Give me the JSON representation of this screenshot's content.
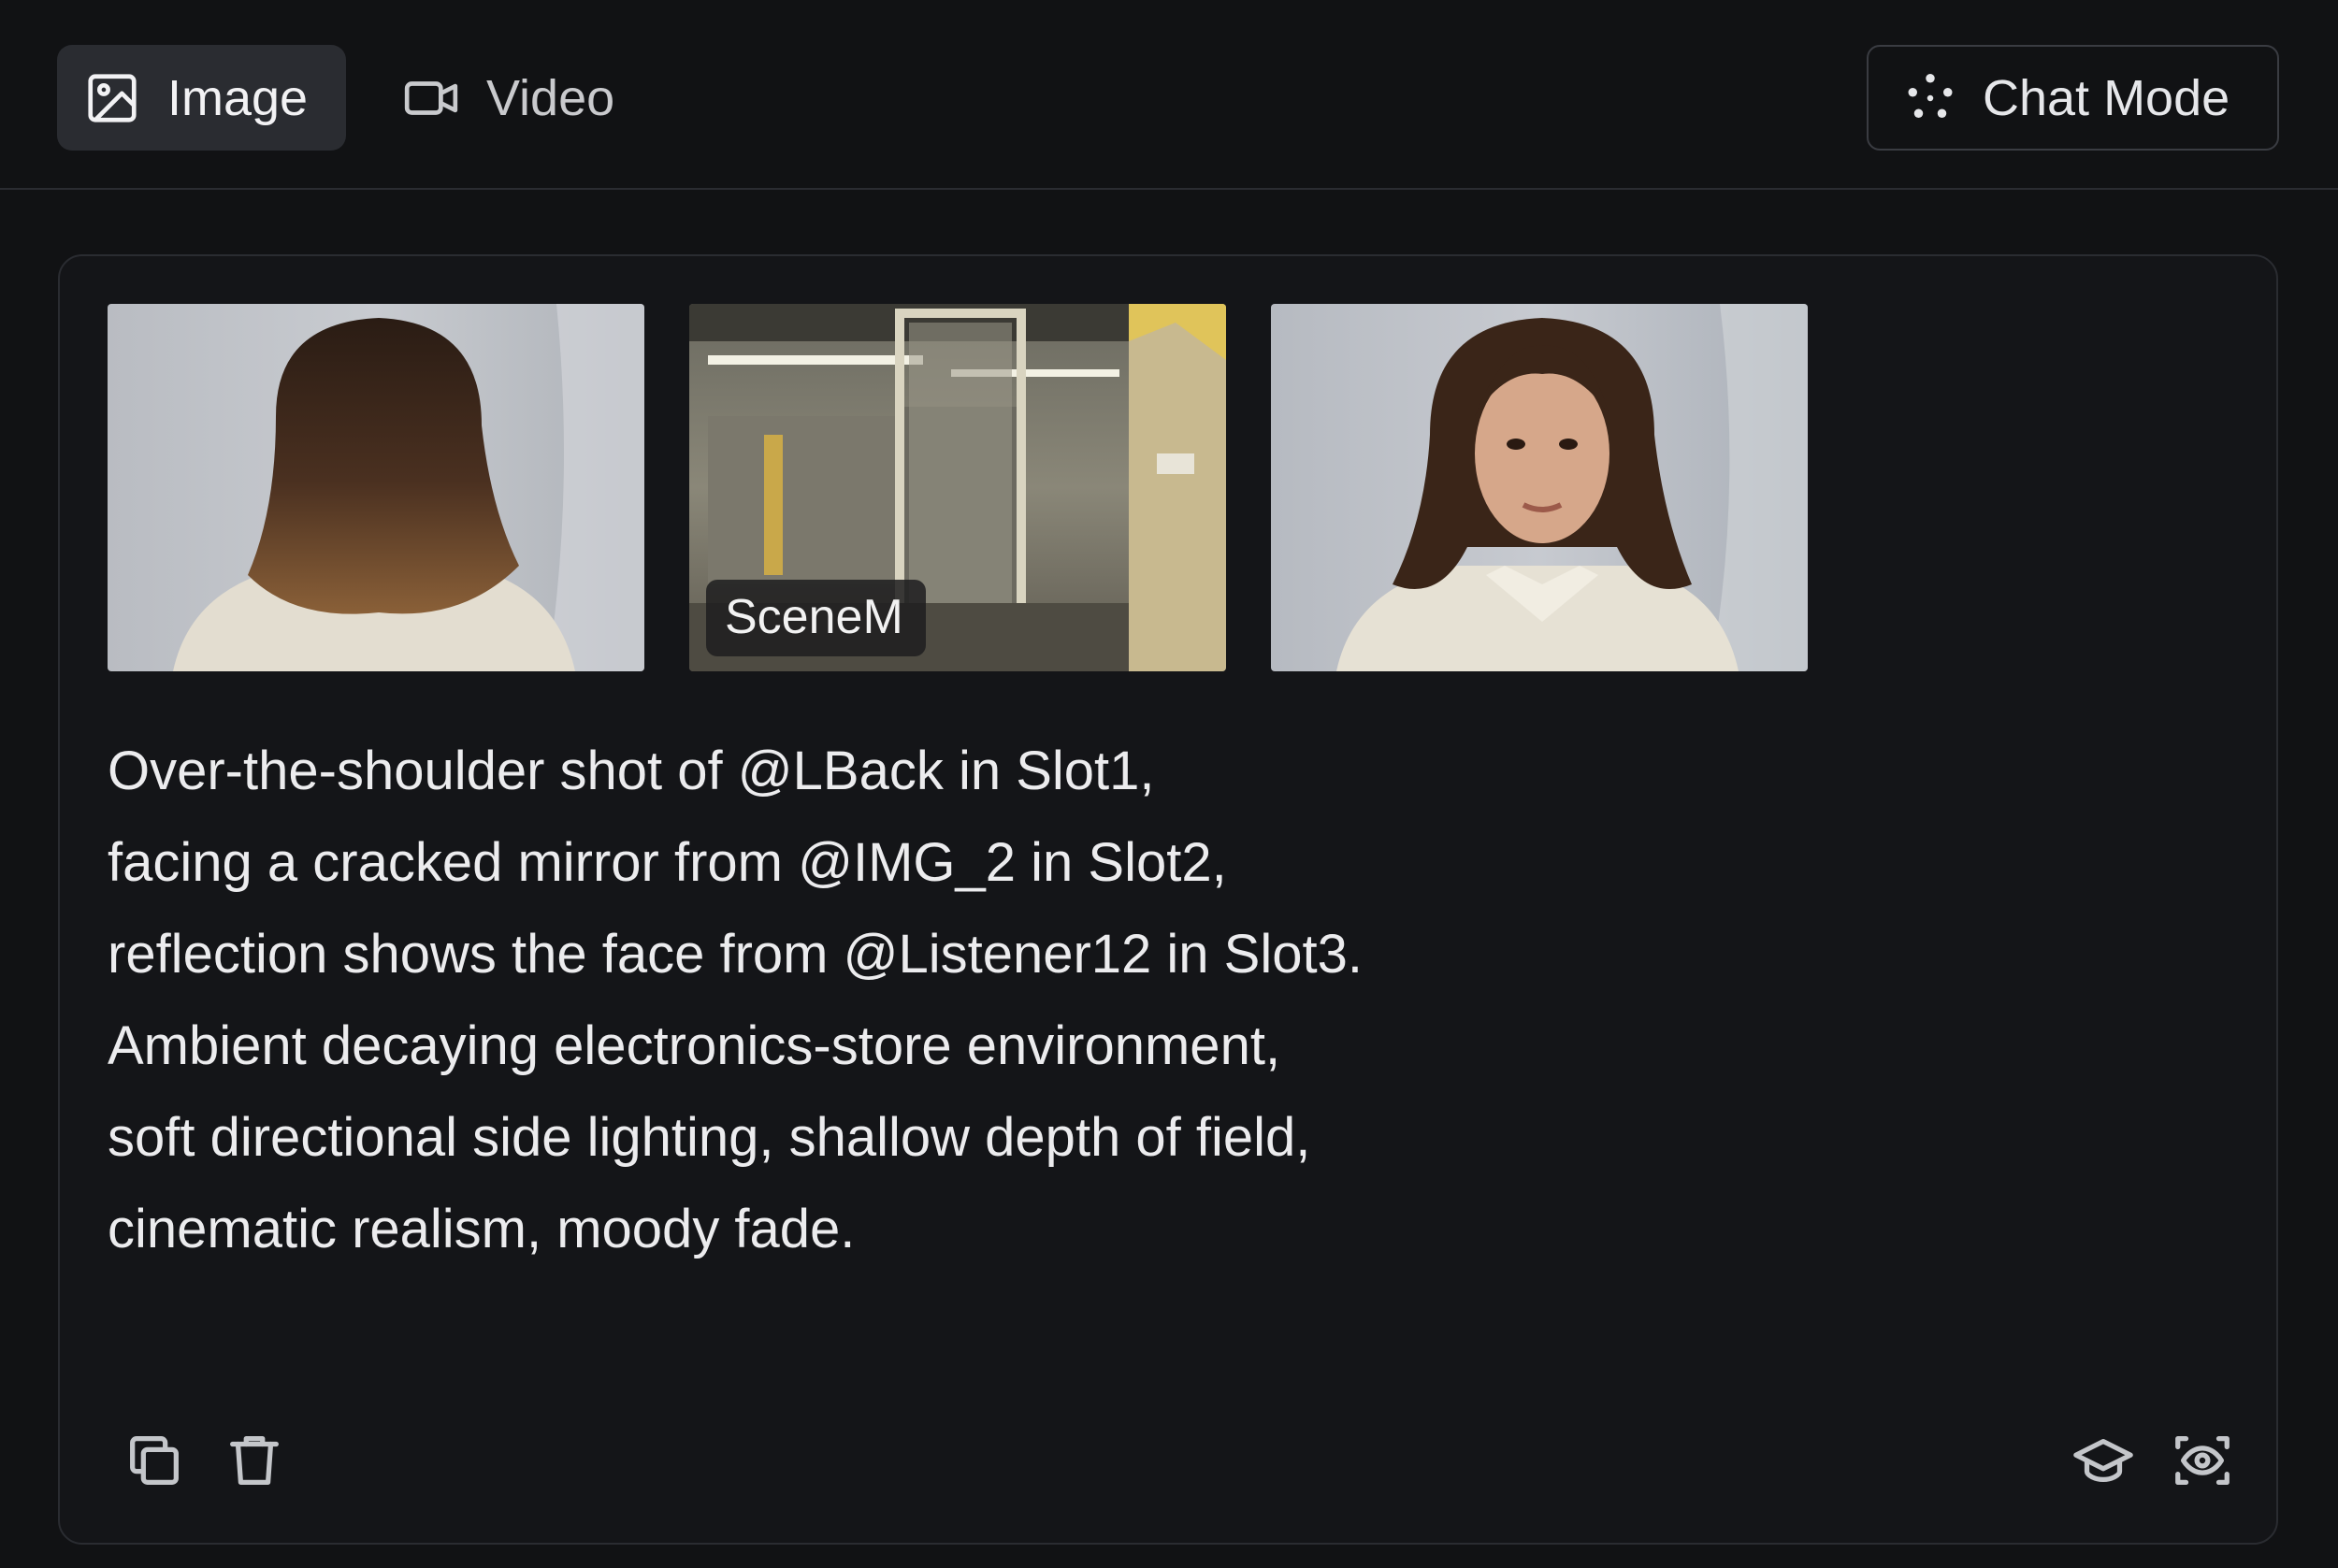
{
  "header": {
    "tabs": [
      {
        "label": "Image",
        "icon": "image-icon",
        "active": true
      },
      {
        "label": "Video",
        "icon": "video-camera-icon",
        "active": false
      }
    ],
    "chat_mode_label": "Chat Mode",
    "chat_mode_icon": "sparkle-dots-icon"
  },
  "panel": {
    "thumbnails": [
      {
        "label": "",
        "description_icon": "woman-back-view"
      },
      {
        "label": "SceneM",
        "description_icon": "store-scene"
      },
      {
        "label": "",
        "description_icon": "woman-portrait"
      }
    ],
    "prompt_lines": [
      "Over-the-shoulder shot of @LBack in Slot1,",
      "facing a cracked mirror from @IMG_2 in Slot2,",
      "reflection shows the face from @Listener12 in Slot3.",
      "Ambient decaying electronics-store environment,",
      "soft directional side lighting, shallow depth of field,",
      "cinematic realism, moody fade."
    ],
    "actions": [
      {
        "icon": "copy-icon"
      },
      {
        "icon": "trash-icon"
      },
      {
        "icon": "graduation-cap-icon"
      },
      {
        "icon": "eye-scan-icon"
      }
    ]
  },
  "colors": {
    "background": "#111214",
    "panel": "#141518",
    "active_tab": "#2a2c31",
    "border": "#2a2c31",
    "text": "#ececee"
  }
}
